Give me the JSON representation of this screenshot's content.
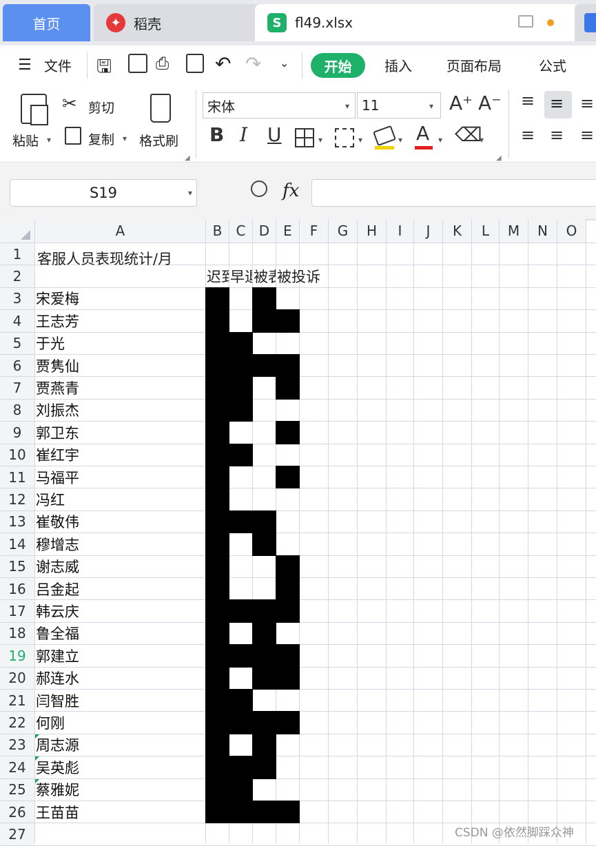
{
  "tabs": {
    "home": "首页",
    "daoke": "稻壳",
    "file": "fl49.xlsx",
    "file_icon": "S",
    "daoke_icon": "稻壳-logo-icon"
  },
  "menu": {
    "file": "文件",
    "items": [
      "开始",
      "插入",
      "页面布局",
      "公式"
    ]
  },
  "ribbon": {
    "paste": "粘贴",
    "cut": "剪切",
    "copy": "复制",
    "format_painter": "格式刷",
    "font": "宋体",
    "font_size": "11",
    "bold": "B",
    "italic": "I",
    "underline": "U"
  },
  "formula": {
    "name_box": "S19",
    "fx": "fx",
    "value": ""
  },
  "sheet": {
    "columns": [
      "A",
      "B",
      "C",
      "D",
      "E",
      "F",
      "G",
      "H",
      "I",
      "J",
      "K",
      "L",
      "M",
      "N",
      "O"
    ],
    "rows": [
      "1",
      "2",
      "3",
      "4",
      "5",
      "6",
      "7",
      "8",
      "9",
      "10",
      "11",
      "12",
      "13",
      "14",
      "15",
      "16",
      "17",
      "18",
      "19",
      "20",
      "21",
      "22",
      "23",
      "24",
      "25",
      "26",
      "27"
    ],
    "title": "客服人员表现统计/月",
    "headers": [
      "迟到",
      "早退",
      "被表扬",
      "被投诉"
    ],
    "header_visible": [
      "迟到",
      "早退",
      "被表扬",
      "被投诉"
    ],
    "names": [
      "宋爱梅",
      "王志芳",
      "于光",
      "贾隽仙",
      "贾燕青",
      "刘振杰",
      "郭卫东",
      "崔红宇",
      "马福平",
      "冯红",
      "崔敬伟",
      "穆增志",
      "谢志威",
      "吕金起",
      "韩云庆",
      "鲁全福",
      "郭建立",
      "郝连水",
      "闫智胜",
      "何刚",
      "周志源",
      "吴英彪",
      "蔡雅妮",
      "王苗苗"
    ],
    "filled": [
      [
        1,
        0,
        1,
        0
      ],
      [
        1,
        0,
        1,
        1
      ],
      [
        1,
        1,
        0,
        0
      ],
      [
        1,
        1,
        1,
        1
      ],
      [
        1,
        1,
        0,
        1
      ],
      [
        1,
        1,
        0,
        0
      ],
      [
        1,
        0,
        0,
        1
      ],
      [
        1,
        1,
        0,
        0
      ],
      [
        1,
        0,
        0,
        1
      ],
      [
        1,
        0,
        0,
        0
      ],
      [
        1,
        1,
        1,
        0
      ],
      [
        1,
        0,
        1,
        0
      ],
      [
        1,
        0,
        0,
        1
      ],
      [
        1,
        0,
        0,
        1
      ],
      [
        1,
        1,
        1,
        1
      ],
      [
        1,
        0,
        1,
        0
      ],
      [
        1,
        1,
        1,
        1
      ],
      [
        1,
        0,
        1,
        1
      ],
      [
        1,
        1,
        0,
        0
      ],
      [
        1,
        1,
        1,
        1
      ],
      [
        1,
        0,
        1,
        0
      ],
      [
        1,
        1,
        1,
        0
      ],
      [
        1,
        1,
        0,
        0
      ],
      [
        1,
        1,
        1,
        1
      ]
    ],
    "active_row": "19",
    "fill_color": "#000000",
    "text_cells": [
      "23",
      "24",
      "25"
    ]
  },
  "watermark": "CSDN @依然脚踩众神",
  "colors": {
    "accent_green": "#1fb06a",
    "home_tab": "#5b8ff0"
  }
}
